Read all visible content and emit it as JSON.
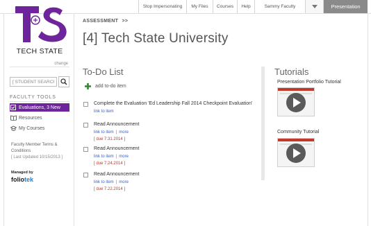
{
  "topnav": {
    "items": [
      "Stop Impersonating",
      "My Files",
      "Courses",
      "Help",
      "Sammy Faculty"
    ],
    "presentation_label": "Presentation"
  },
  "logo": {
    "text": "TECH STATE",
    "change_label": "change",
    "brand_color": "#6e259c"
  },
  "search": {
    "value": "[ STUDENT SEARCH ]"
  },
  "faculty_tools": {
    "heading": "FACULTY TOOLS",
    "items": [
      {
        "label": "Evaluations, 3 New",
        "icon": "evaluations-icon",
        "active": true
      },
      {
        "label": "Resources",
        "icon": "resources-icon",
        "active": false
      },
      {
        "label": "My Courses",
        "icon": "courses-icon",
        "active": false
      }
    ]
  },
  "terms": {
    "label": "Faculty Member Terms & Conditions",
    "updated": "[ Last Updated 10/15/2013 ]"
  },
  "managed": {
    "label": "Managed by",
    "brand_main": "folio",
    "brand_accent": "tek"
  },
  "main": {
    "breadcrumb": "ASSESSMENT",
    "breadcrumb_arrow": ">>",
    "title": "[4] Tech State University"
  },
  "todo": {
    "heading": "To-Do List",
    "add_label": "add to-do item",
    "link_label": "link to item",
    "more_label": "more",
    "items": [
      {
        "title": "Complete the Evaluation 'Ed Leadership Fall 2014 Checkpoint Evaluation'",
        "due": ""
      },
      {
        "title": "Read Announcement",
        "due": "[ due 7.31.2014 ]"
      },
      {
        "title": "Read Announcement",
        "due": "[ due 7.24.2014 ]"
      },
      {
        "title": "Read Announcement",
        "due": "[ due 7.22.2014 ]"
      }
    ]
  },
  "tutorials": {
    "heading": "Tutorials",
    "items": [
      {
        "label": "Presentation Portfolio Tutorial"
      },
      {
        "label": "Community Tutorial"
      }
    ]
  }
}
